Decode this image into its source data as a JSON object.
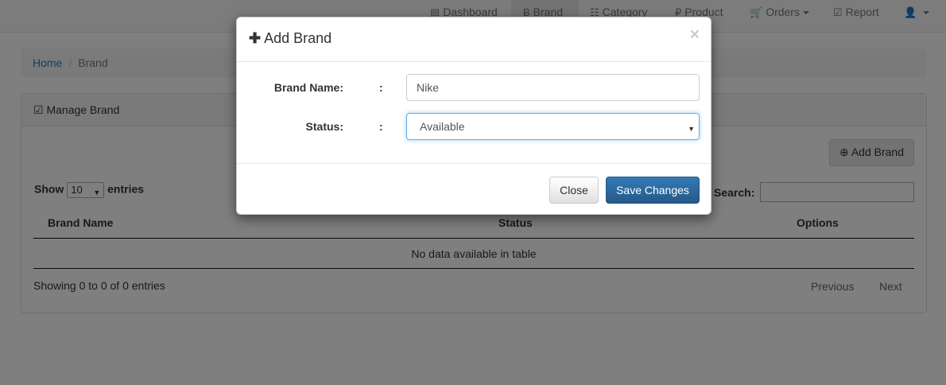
{
  "navbar": {
    "items": [
      {
        "icon": "list-icon",
        "glyph": "▤",
        "label": "Dashboard"
      },
      {
        "icon": "bitcoin-icon",
        "glyph": "Ƀ",
        "label": "Brand"
      },
      {
        "icon": "th-list-icon",
        "glyph": "☷",
        "label": "Category"
      },
      {
        "icon": "ruble-icon",
        "glyph": "₽",
        "label": "Product"
      },
      {
        "icon": "cart-icon",
        "glyph": "🛒",
        "label": "Orders"
      },
      {
        "icon": "check-square-icon",
        "glyph": "☑",
        "label": "Report"
      },
      {
        "icon": "user-icon",
        "glyph": "👤",
        "label": ""
      }
    ],
    "active": "Brand"
  },
  "breadcrumb": {
    "home": "Home",
    "sep": "/",
    "current": "Brand"
  },
  "panel": {
    "heading_icon": "edit-icon",
    "heading": "Manage Brand",
    "add_button": "Add Brand",
    "show_label": "Show",
    "entries_value": "10",
    "entries_label": "entries",
    "search_label": "Search:",
    "columns": [
      "Brand Name",
      "Status",
      "Options"
    ],
    "empty_message": "No data available in table",
    "info": "Showing 0 to 0 of 0 entries",
    "previous": "Previous",
    "next": "Next"
  },
  "modal": {
    "title": "Add Brand",
    "close_glyph": "×",
    "colon": ":",
    "brand_name_label": "Brand Name:",
    "brand_name_value": "Nike",
    "status_label": "Status:",
    "status_value": "Available",
    "close_button": "Close",
    "save_button": "Save Changes"
  },
  "colors": {
    "primary": "#337ab7",
    "backdrop": "rgba(0,0,0,0.5)"
  }
}
